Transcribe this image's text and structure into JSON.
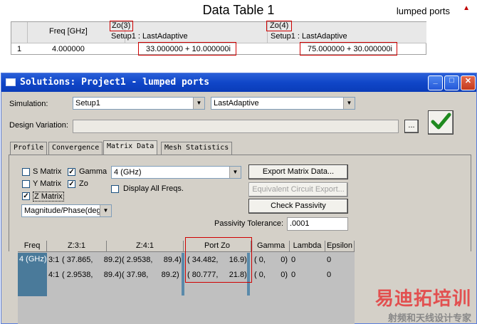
{
  "data_table": {
    "title": "Data Table 1",
    "brand": "lumped ports",
    "mark": "♐",
    "headers": {
      "freq": "Freq [GHz]",
      "zo3": "Zo(3)",
      "zo3_sub": "Setup1 : LastAdaptive",
      "zo4": "Zo(4)",
      "zo4_sub": "Setup1 : LastAdaptive"
    },
    "row": {
      "index": "1",
      "freq": "4.000000",
      "zo3": "33.000000 + 10.000000i",
      "zo4": "75.000000 + 30.000000i"
    }
  },
  "dialog": {
    "title": "Solutions: Project1 - lumped ports",
    "simulation_label": "Simulation:",
    "simulation_value": "Setup1",
    "adaptive_value": "LastAdaptive",
    "design_variation_label": "Design Variation:",
    "browse_label": "...",
    "tabs": [
      "Profile",
      "Convergence",
      "Matrix Data",
      "Mesh Statistics"
    ],
    "checks": {
      "s_matrix": "S Matrix",
      "gamma": "Gamma",
      "y_matrix": "Y Matrix",
      "zo": "Zo",
      "z_matrix": "Z Matrix",
      "display_all": "Display All Freqs."
    },
    "freq_select": "4 (GHz)",
    "format_select": "Magnitude/Phase(deg",
    "buttons": {
      "export": "Export Matrix Data...",
      "equivalent": "Equivalent Circuit Export...",
      "passivity": "Check Passivity"
    },
    "passivity_label": "Passivity Tolerance:",
    "passivity_value": ".0001",
    "grid": {
      "headers": [
        "Freq",
        "Z:3:1",
        "Z:4:1",
        "Port Zo",
        "Gamma",
        "Lambda",
        "Epsilon"
      ],
      "freq_cell": "4 (GHz)",
      "rows": [
        {
          "label": "3:1",
          "z31": "( 37.865,     89.2)",
          "z41": "( 2.9538,     89.4)",
          "port_zo": "( 34.482,     16.9)",
          "gamma": "( 0,       0)",
          "lambda": "0",
          "epsilon": "0"
        },
        {
          "label": "4:1",
          "z31": "( 2.9538,     89.4)",
          "z41": "( 37.98,      89.2)",
          "port_zo": "( 80.777,     21.8)",
          "gamma": "( 0,       0)",
          "lambda": "0",
          "epsilon": "0"
        }
      ]
    }
  },
  "watermark": {
    "main": "易迪拓培训",
    "sub": "射频和天线设计专家"
  }
}
